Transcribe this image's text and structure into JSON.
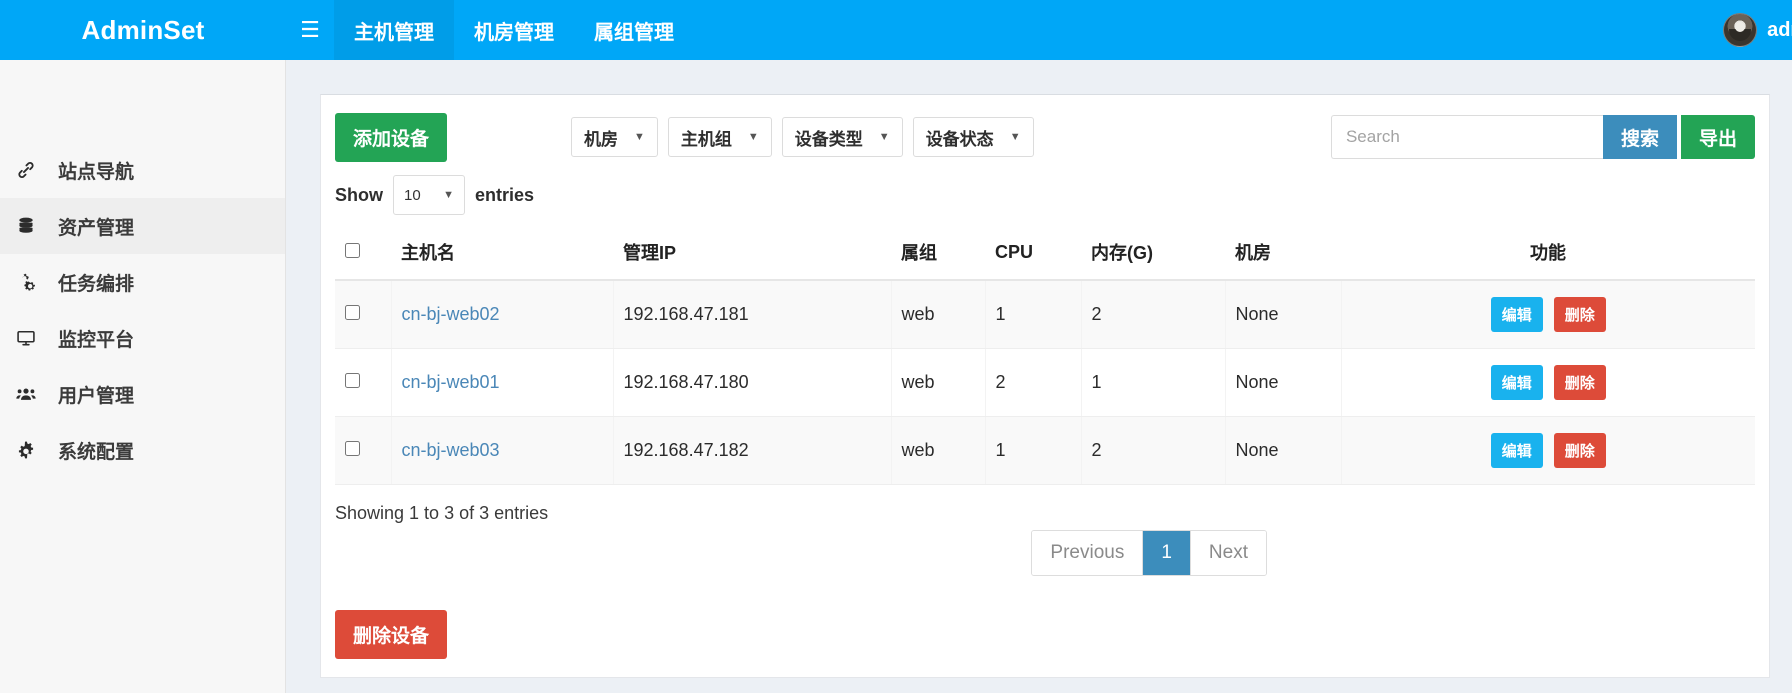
{
  "navbar": {
    "brand": "AdminSet",
    "hamburger_icon": "hamburger-icon",
    "items": [
      {
        "label": "主机管理",
        "active": true
      },
      {
        "label": "机房管理",
        "active": false
      },
      {
        "label": "属组管理",
        "active": false
      }
    ],
    "user": {
      "name": "admin",
      "avatar_icon": "user-avatar"
    }
  },
  "sidebar": {
    "items": [
      {
        "label": "站点导航",
        "icon": "link-icon",
        "active": false
      },
      {
        "label": "资产管理",
        "icon": "database-icon",
        "active": true
      },
      {
        "label": "任务编排",
        "icon": "gears-icon",
        "active": false
      },
      {
        "label": "监控平台",
        "icon": "desktop-icon",
        "active": false
      },
      {
        "label": "用户管理",
        "icon": "users-icon",
        "active": false
      },
      {
        "label": "系统配置",
        "icon": "gear-icon",
        "active": false
      }
    ]
  },
  "toolbar": {
    "add_label": "添加设备",
    "filters": [
      {
        "label": "机房"
      },
      {
        "label": "主机组"
      },
      {
        "label": "设备类型"
      },
      {
        "label": "设备状态"
      }
    ],
    "search_placeholder": "Search",
    "search_value": "",
    "search_label": "搜索",
    "export_label": "导出"
  },
  "length_menu": {
    "show_label": "Show",
    "value": "10",
    "entries_label": "entries"
  },
  "table": {
    "columns": [
      "主机名",
      "管理IP",
      "属组",
      "CPU",
      "内存(G)",
      "机房",
      "功能"
    ],
    "rows": [
      {
        "host": "cn-bj-web02",
        "ip": "192.168.47.181",
        "group": "web",
        "cpu": "1",
        "mem": "2",
        "room": "None",
        "edit_label": "编辑",
        "delete_label": "删除"
      },
      {
        "host": "cn-bj-web01",
        "ip": "192.168.47.180",
        "group": "web",
        "cpu": "2",
        "mem": "1",
        "room": "None",
        "edit_label": "编辑",
        "delete_label": "删除"
      },
      {
        "host": "cn-bj-web03",
        "ip": "192.168.47.182",
        "group": "web",
        "cpu": "1",
        "mem": "2",
        "room": "None",
        "edit_label": "编辑",
        "delete_label": "删除"
      }
    ]
  },
  "footer": {
    "info": "Showing 1 to 3 of 3 entries",
    "pagination": {
      "previous": "Previous",
      "page": "1",
      "next": "Next"
    },
    "delete_device_label": "删除设备"
  },
  "colors": {
    "navbar": "#00a7f7",
    "primary_green": "#23a455",
    "primary_blue": "#3c8dbc",
    "edit_blue": "#19b2ee",
    "danger_red": "#dd4b39",
    "link": "#4a87b7",
    "page_bg": "#ecf0f5",
    "sidebar_bg": "#f7f7f7"
  }
}
